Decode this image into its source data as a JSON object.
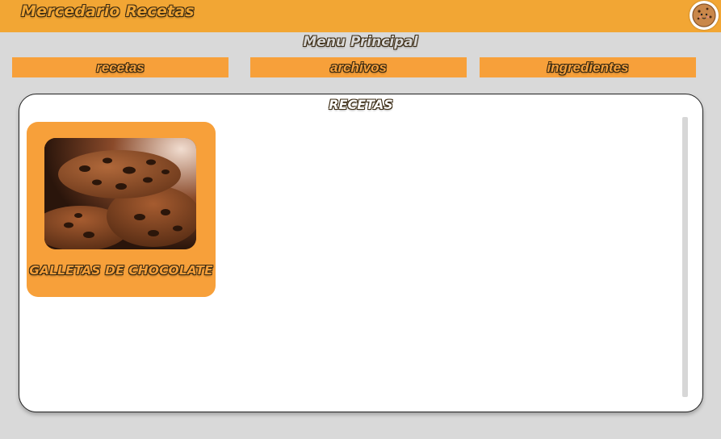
{
  "header": {
    "app_title": "Mercedario Recetas",
    "logo_icon": "cookie-face-icon",
    "color": "#f2a634"
  },
  "menu": {
    "title": "Menu Principal",
    "items": [
      {
        "label": "recetas"
      },
      {
        "label": "archivos"
      },
      {
        "label": "ingredientes"
      }
    ]
  },
  "recipes_panel": {
    "title": "RECETAS",
    "cards": [
      {
        "title": "GALLETAS DE CHOCOLATE",
        "image_icon": "chocolate-chip-cookies-image"
      }
    ]
  },
  "colors": {
    "accent": "#f7a03a",
    "background": "#d9d9d9",
    "panel": "#ffffff"
  }
}
